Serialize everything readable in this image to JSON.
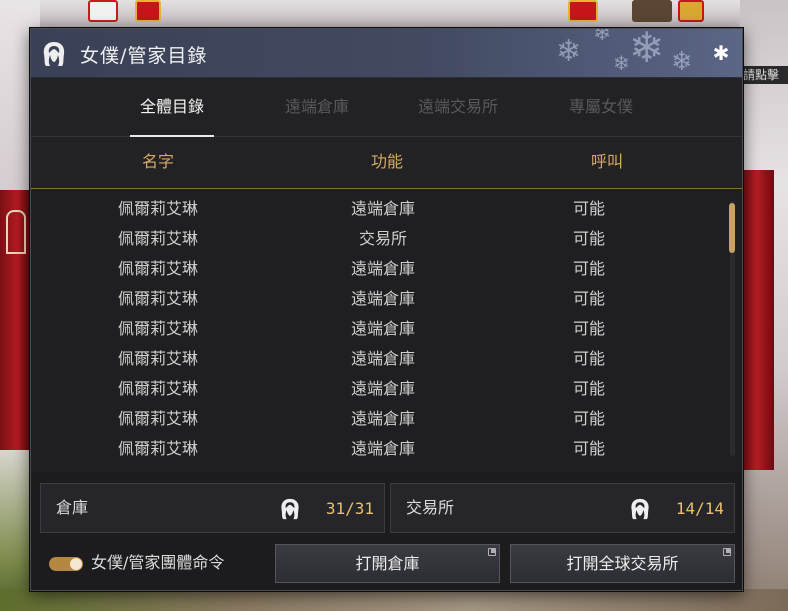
{
  "background": {
    "hint_text": "請點擊"
  },
  "window": {
    "title": "女僕/管家目錄",
    "title_icon": "maid-silhouette-icon",
    "close_icon": "snowflake-close-icon"
  },
  "tabs": [
    {
      "label": "全體目錄",
      "active": true
    },
    {
      "label": "遠端倉庫",
      "active": false
    },
    {
      "label": "遠端交易所",
      "active": false
    },
    {
      "label": "專屬女僕",
      "active": false
    }
  ],
  "columns": {
    "name": "名字",
    "function": "功能",
    "call": "呼叫"
  },
  "rows": [
    {
      "name": "佩爾莉艾琳",
      "function": "遠端倉庫",
      "call": "可能"
    },
    {
      "name": "佩爾莉艾琳",
      "function": "交易所",
      "call": "可能"
    },
    {
      "name": "佩爾莉艾琳",
      "function": "遠端倉庫",
      "call": "可能"
    },
    {
      "name": "佩爾莉艾琳",
      "function": "遠端倉庫",
      "call": "可能"
    },
    {
      "name": "佩爾莉艾琳",
      "function": "遠端倉庫",
      "call": "可能"
    },
    {
      "name": "佩爾莉艾琳",
      "function": "遠端倉庫",
      "call": "可能"
    },
    {
      "name": "佩爾莉艾琳",
      "function": "遠端倉庫",
      "call": "可能"
    },
    {
      "name": "佩爾莉艾琳",
      "function": "遠端倉庫",
      "call": "可能"
    },
    {
      "name": "佩爾莉艾琳",
      "function": "遠端倉庫",
      "call": "可能"
    }
  ],
  "summary": {
    "warehouse": {
      "label": "倉庫",
      "count": "31/31",
      "icon": "maid-silhouette-icon"
    },
    "market": {
      "label": "交易所",
      "count": "14/14",
      "icon": "maid-silhouette-icon"
    }
  },
  "controls": {
    "group_command_label": "女僕/管家團體命令",
    "group_command_on": true,
    "open_warehouse_label": "打開倉庫",
    "open_market_label": "打開全球交易所"
  },
  "colors": {
    "accent_gold": "#d7a963",
    "count_gold": "#e9c06b",
    "title_bar": "#424a62"
  }
}
